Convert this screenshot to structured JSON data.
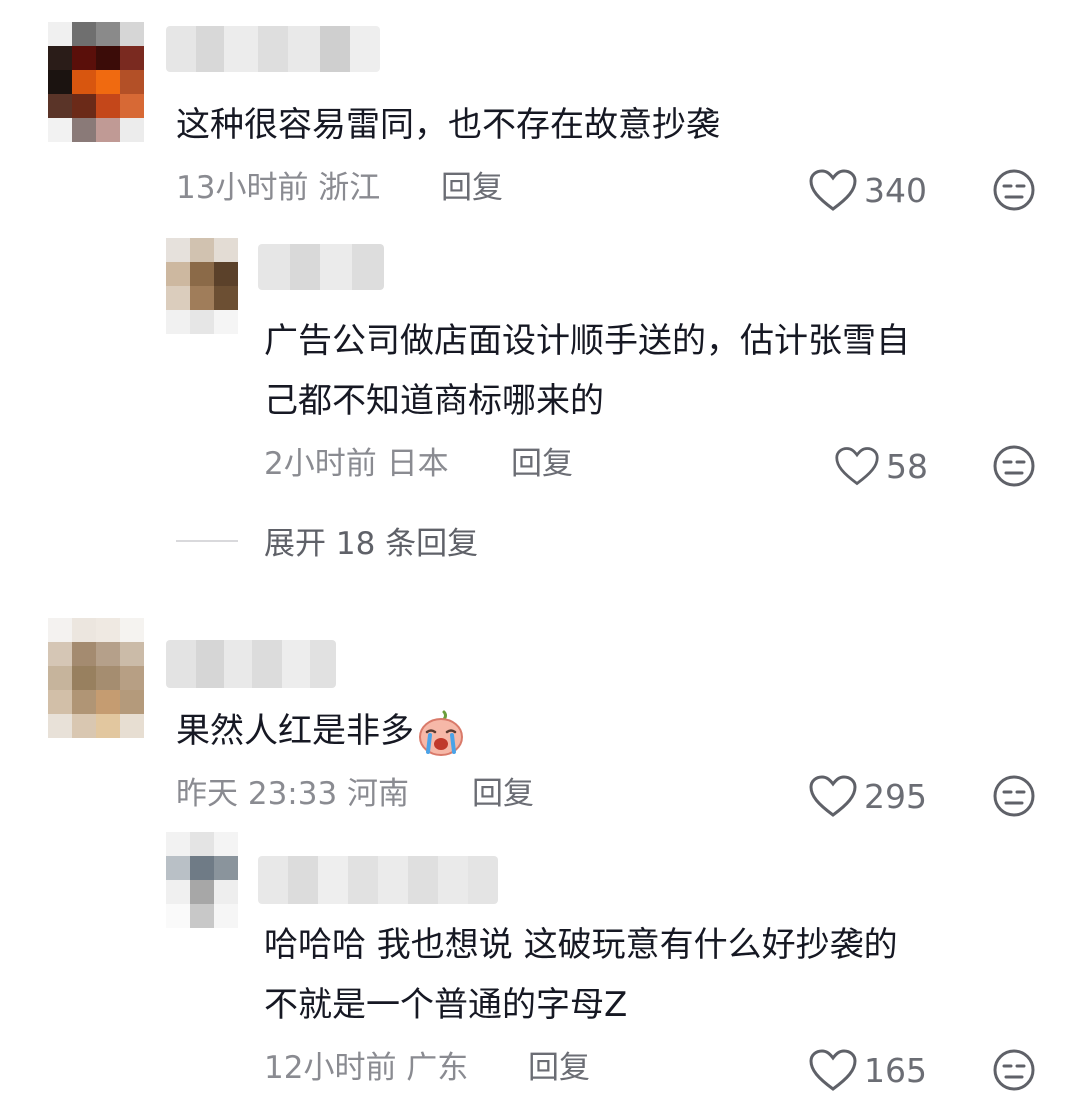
{
  "comments": [
    {
      "text": "这种很容易雷同，也不存在故意抄袭",
      "time_location": "13小时前 浙江",
      "reply_label": "回复",
      "likes": "340",
      "avatar_colors": [
        "#c9c9c9",
        "#6f6f6f",
        "#8a8a8a",
        "#d6d6d6",
        "#2a1c18",
        "#5a0f0a",
        "#3b0c08",
        "#7a2a20",
        "#1b1310",
        "#d8560f",
        "#f06a10",
        "#b35027",
        "#5a3428",
        "#6b2a18",
        "#c4471a",
        "#d76935",
        "#d2d2d2",
        "#8a7a78",
        "#c09a95",
        "#e6e6e6"
      ],
      "replies": [
        {
          "text_line1": "广告公司做店面设计顺手送的，估计张雪自",
          "text_line2": "己都不知道商标哪来的",
          "time_location": "2小时前 日本",
          "reply_label": "回复",
          "likes": "58"
        }
      ],
      "expand_label": "展开 18 条回复"
    },
    {
      "text": "果然人红是非多",
      "time_location": "昨天 23:33 河南",
      "reply_label": "回复",
      "likes": "295",
      "replies": [
        {
          "text_line1": "哈哈哈 我也想说 这破玩意有什么好抄袭的",
          "text_line2": "不就是一个普通的字母Z",
          "time_location": "12小时前 广东",
          "reply_label": "回复",
          "likes": "165"
        }
      ]
    }
  ]
}
